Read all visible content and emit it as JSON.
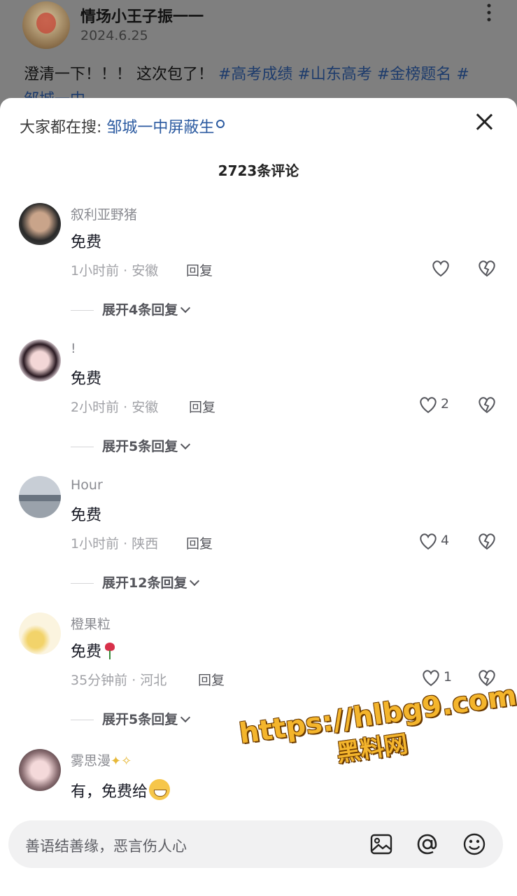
{
  "post": {
    "author": "情场小王子振一一",
    "date": "2024.6.25",
    "text_prefix": "澄清一下！！！ 这次包了！ ",
    "tags": [
      "#高考成绩",
      "#山东高考",
      "#金榜题名",
      "#"
    ],
    "text_line2": "邹城一中"
  },
  "sheet": {
    "search_label": "大家都在搜: ",
    "search_keyword": "邹城一中屏蔽生",
    "comment_count": "2723条评论"
  },
  "comments": [
    {
      "name": "叙利亚野猪",
      "text": "免费",
      "meta": "1小时前 · 安徽",
      "reply": "回复",
      "likes": "",
      "expand": "展开4条回复"
    },
    {
      "name": "!",
      "text": "免费",
      "meta": "2小时前 · 安徽",
      "reply": "回复",
      "likes": "2",
      "expand": "展开5条回复"
    },
    {
      "name": "Hour",
      "text": "免费",
      "meta": "1小时前 · 陕西",
      "reply": "回复",
      "likes": "4",
      "expand": "展开12条回复"
    },
    {
      "name": "橙果粒",
      "text": "免费",
      "meta": "35分钟前 · 河北",
      "reply": "回复",
      "likes": "1",
      "expand": "展开5条回复"
    },
    {
      "name": "雾思漫",
      "text": "有，免费给",
      "meta": "",
      "reply": "",
      "likes": "",
      "expand": ""
    }
  ],
  "watermark": {
    "line1": "https://hlbg9.com",
    "line2": "黑料网"
  },
  "input": {
    "placeholder": "善语结善缘，恶言伤人心"
  },
  "icons": {
    "more": "more-vertical-icon",
    "close": "close-icon",
    "search": "search-icon",
    "like": "heart-outline-icon",
    "dislike": "broken-heart-icon",
    "image": "image-icon",
    "mention": "at-icon",
    "emoji": "emoji-icon"
  }
}
